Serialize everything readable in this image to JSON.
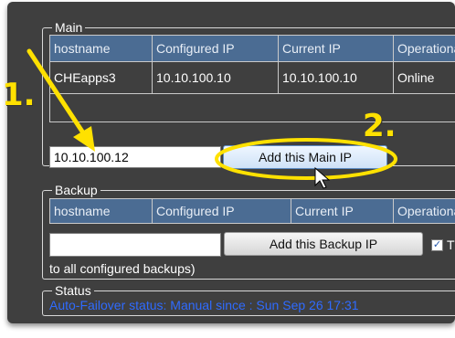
{
  "annotations": {
    "step1": "1.",
    "step2": "2."
  },
  "main": {
    "legend": "Main",
    "columns": [
      "hostname",
      "Configured IP",
      "Current IP",
      "Operational"
    ],
    "rows": [
      [
        "CHEapps3",
        "10.10.100.10",
        "10.10.100.10",
        "Online"
      ]
    ],
    "ip_input_value": "10.10.100.12",
    "add_button": "Add this Main IP"
  },
  "backup": {
    "legend": "Backup",
    "columns": [
      "hostname",
      "Configured IP",
      "Current IP",
      "Operational"
    ],
    "ip_input_value": "",
    "add_button": "Add this Backup IP",
    "checkbox_checked": true,
    "checkbox_label_start": "T",
    "continuation_text": "to all configured backups)"
  },
  "status": {
    "legend": "Status",
    "text": "Auto-Failover status: Manual since : Sun Sep 26 17:31"
  },
  "colors": {
    "panel": "#3f3f3f",
    "header": "#4b6c93",
    "status_text": "#2f6bff",
    "highlight": "#ffe100"
  }
}
